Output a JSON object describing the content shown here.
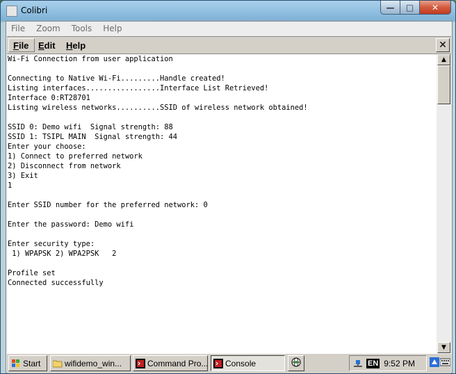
{
  "window": {
    "title": "Colibri",
    "minimize_glyph": "—",
    "maximize_glyph": "□",
    "close_glyph": "✕"
  },
  "outer_menu": [
    "File",
    "Zoom",
    "Tools",
    "Help"
  ],
  "ce_menu": {
    "file_u": "F",
    "file_rest": "ile",
    "edit_u": "E",
    "edit_rest": "dit",
    "help_u": "H",
    "help_rest": "elp",
    "close_glyph": "✕"
  },
  "console": {
    "lines": [
      "Wi-Fi Connection from user application",
      "",
      "Connecting to Native Wi-Fi.........Handle created!",
      "Listing interfaces.................Interface List Retrieved!",
      "Interface 0:RT28701",
      "Listing wireless networks..........SSID of wireless network obtained!",
      "",
      "SSID 0: Demo wifi  Signal strength: 88",
      "SSID 1: TSIPL MAIN  Signal strength: 44",
      "Enter your choose:",
      "1) Connect to preferred network",
      "2) Disconnect from network",
      "3) Exit",
      "1",
      "",
      "Enter SSID number for the preferred network: 0",
      "",
      "Enter the password: Demo wifi",
      "",
      "Enter security type:",
      " 1) WPAPSK 2) WPA2PSK   2",
      "",
      "Profile set",
      "Connected successfully"
    ]
  },
  "scrollbar": {
    "up_glyph": "▲",
    "down_glyph": "▼"
  },
  "taskbar": {
    "start": "Start",
    "wifi": "wifidemo_win...",
    "cmd": "Command Pro...",
    "console": "Console",
    "lang": "EN",
    "time": "9:52 PM"
  },
  "colors": {
    "titlebar": "#8fbfe0",
    "ce_face": "#d4d0c8",
    "console_bg": "#ffffff"
  }
}
